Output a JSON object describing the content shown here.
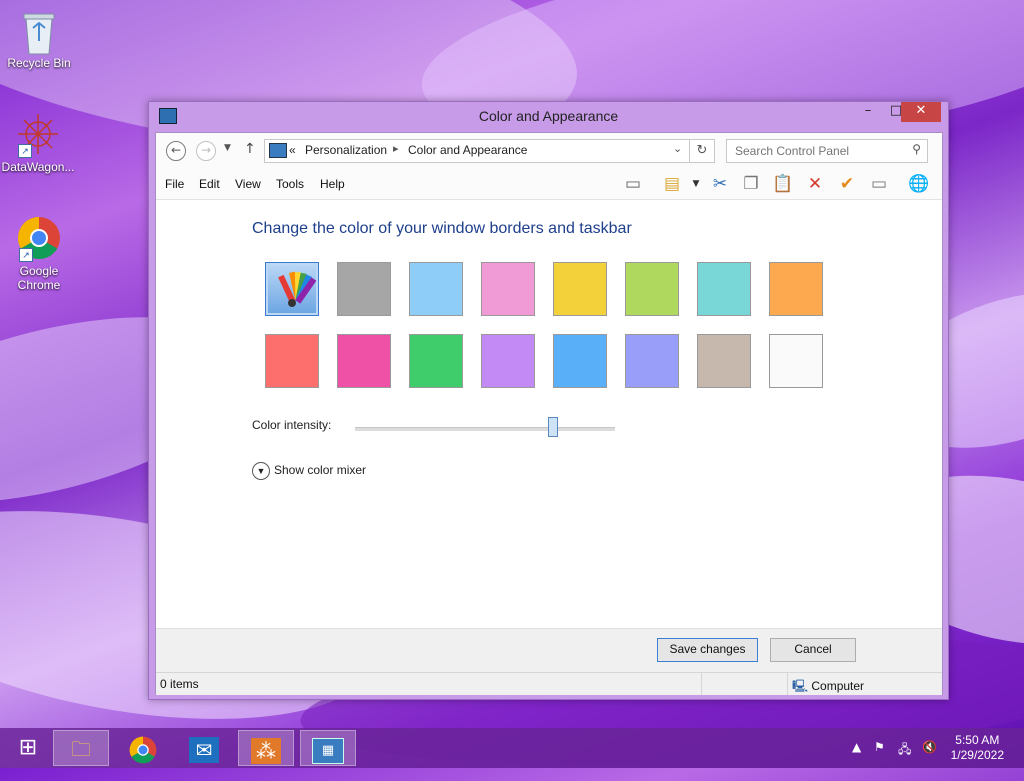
{
  "desktop": {
    "icons": [
      {
        "label": "Recycle Bin"
      },
      {
        "label": "DataWagon..."
      },
      {
        "label": "Google Chrome"
      }
    ]
  },
  "window": {
    "title": "Color and Appearance",
    "address": {
      "overflow": "«",
      "crumbs": [
        "Personalization",
        "Color and Appearance"
      ],
      "search_placeholder": "Search Control Panel"
    },
    "menu": [
      "File",
      "Edit",
      "View",
      "Tools",
      "Help"
    ],
    "toolbar_icons": [
      "layout-icon",
      "folder-options-icon",
      "cut-icon",
      "copy-icon",
      "paste-icon",
      "delete-icon",
      "checkmark-icon",
      "properties-icon",
      "globe-icon"
    ],
    "heading": "Change the color of your window borders and taskbar",
    "swatches": [
      {
        "name": "automatic",
        "color": "#8ab9e8",
        "selected": true
      },
      {
        "name": "gray",
        "color": "#a6a6a6"
      },
      {
        "name": "sky-blue",
        "color": "#8ecdf8"
      },
      {
        "name": "pink",
        "color": "#f19bd6"
      },
      {
        "name": "yellow",
        "color": "#f3d13b"
      },
      {
        "name": "lime",
        "color": "#aed85e"
      },
      {
        "name": "teal",
        "color": "#7ad7d7"
      },
      {
        "name": "orange",
        "color": "#fda950"
      },
      {
        "name": "red",
        "color": "#fd6f6c"
      },
      {
        "name": "magenta",
        "color": "#ef51a7"
      },
      {
        "name": "green",
        "color": "#3fcd6b"
      },
      {
        "name": "lavender",
        "color": "#c389f5"
      },
      {
        "name": "blue",
        "color": "#5ab0f8"
      },
      {
        "name": "periwinkle",
        "color": "#999ef8"
      },
      {
        "name": "taupe",
        "color": "#c6b8ac"
      },
      {
        "name": "white",
        "color": "#fafafa"
      }
    ],
    "color_intensity_label": "Color intensity:",
    "color_intensity_value": 0.76,
    "show_mixer_label": "Show color mixer",
    "save_label": "Save changes",
    "cancel_label": "Cancel",
    "status_items": "0 items",
    "status_location": "Computer"
  },
  "taskbar": {
    "apps": [
      "file-explorer",
      "chrome",
      "mail",
      "datawagon",
      "control-panel"
    ],
    "time": "5:50 AM",
    "date": "1/29/2022"
  }
}
